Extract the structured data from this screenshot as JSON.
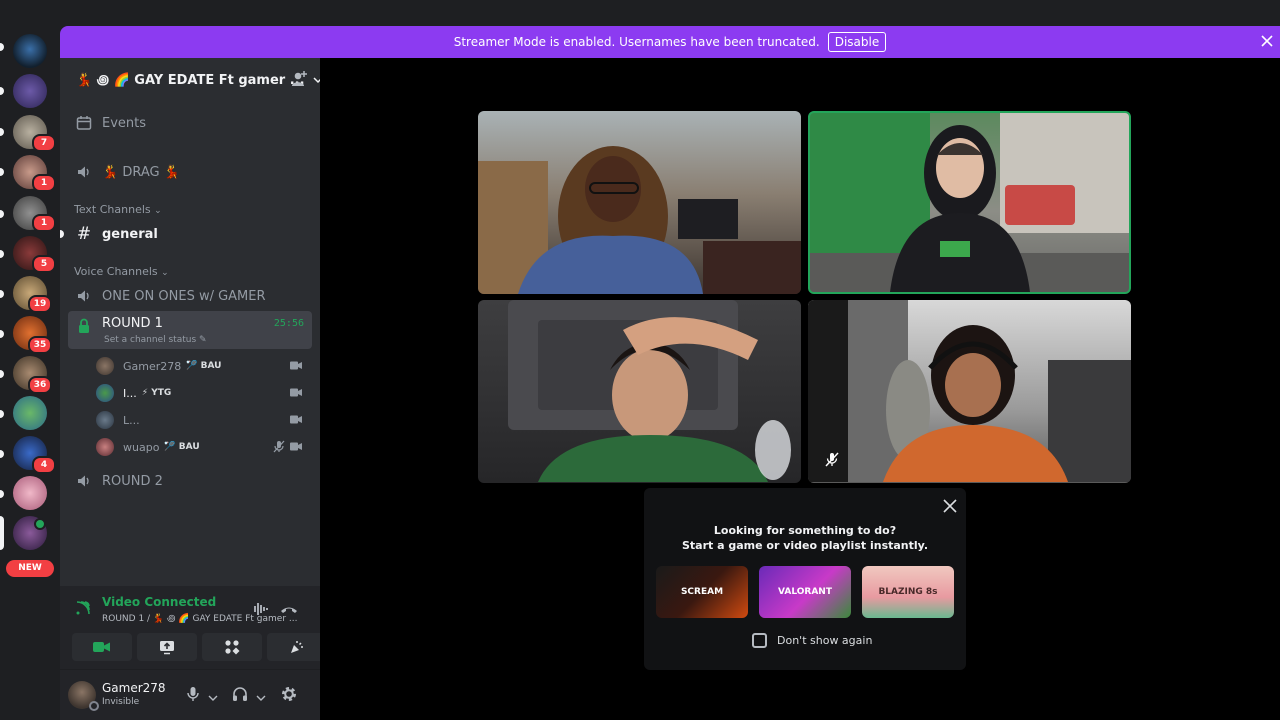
{
  "banner": {
    "message": "Streamer Mode is enabled. Usernames have been truncated.",
    "disable_label": "Disable"
  },
  "server_rail": {
    "badges": [
      "7",
      "1",
      "1",
      "5",
      "19",
      "35",
      "36",
      "4"
    ],
    "new_label": "NEW"
  },
  "guild": {
    "name": "💃 ꩜ 🌈 GAY EDATE Ft gamer ..."
  },
  "channels": {
    "events_label": "Events",
    "drag_label": "💃 DRAG 💃",
    "text_category": "Text Channels",
    "general_label": "general",
    "voice_category": "Voice Channels",
    "one_on_ones_label": "ONE ON ONES w/ GAMER",
    "round1_label": "ROUND 1",
    "round1_timer": "25:56",
    "round1_status": "Set a channel status",
    "round2_label": "ROUND 2",
    "members": [
      {
        "name": "Gamer278",
        "tag": "BAU",
        "tag_icon": "🏸"
      },
      {
        "name": "I...",
        "tag": "YTG",
        "tag_icon": "⚡"
      },
      {
        "name": "L...",
        "tag": "",
        "tag_icon": ""
      },
      {
        "name": "wuapo",
        "tag": "BAU",
        "tag_icon": "🏸"
      }
    ]
  },
  "voice_panel": {
    "title": "Video Connected",
    "subtitle": "ROUND 1 / 💃 ꩜ 🌈 GAY EDATE Ft gamer ..."
  },
  "user_panel": {
    "name": "Gamer278",
    "status": "Invisible"
  },
  "activity_popup": {
    "line1": "Looking for something to do?",
    "line2": "Start a game or video playlist instantly.",
    "activities": [
      "SCREAM",
      "VALORANT",
      "BLAZING 8s"
    ],
    "dont_show_label": "Don't show again"
  },
  "colors": {
    "accent_purple": "#8c3bf1",
    "speaking_green": "#23a55a",
    "badge_red": "#f23f43"
  }
}
